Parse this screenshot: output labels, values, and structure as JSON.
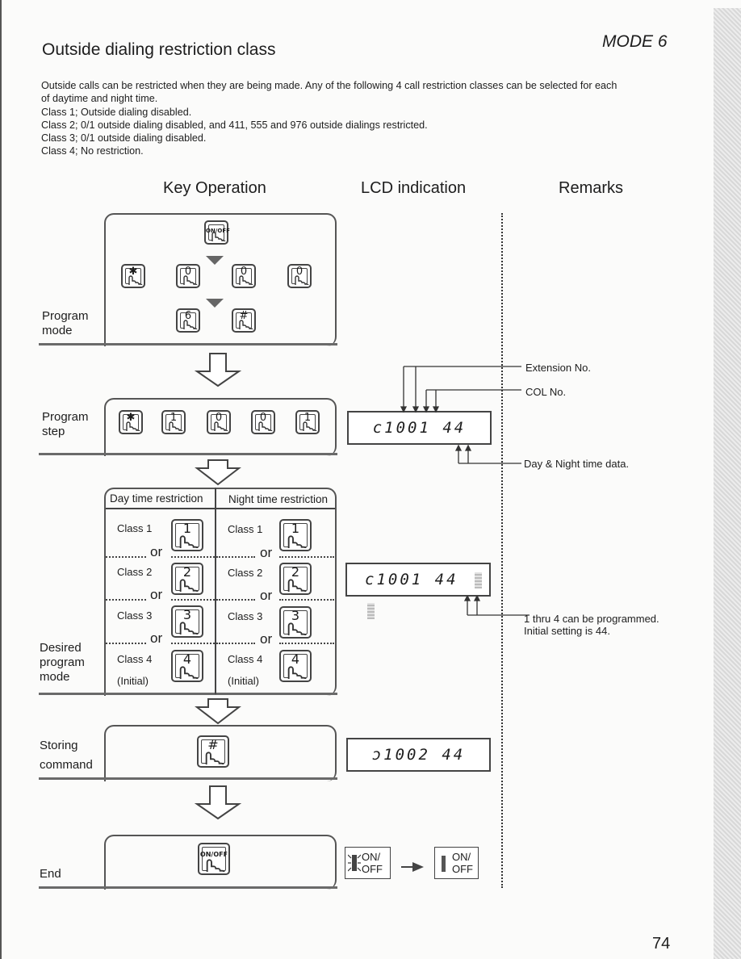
{
  "header": {
    "title": "Outside dialing restriction  class",
    "mode_label": "MODE  6"
  },
  "intro": {
    "lines": [
      "Outside calls can be restricted when they are being made.  Any of the following 4 call restriction classes can be selected for each",
      "of daytime and night time.",
      "Class 1; Outside dialing disabled.",
      "Class 2; 0/1 outside dialing disabled, and 411, 555 and 976 outside dialings restricted.",
      "Class 3; 0/1 outside dialing disabled.",
      "Class 4; No restriction."
    ]
  },
  "columns": {
    "key_operation": "Key Operation",
    "lcd_indication": "LCD  indication",
    "remarks": "Remarks"
  },
  "steps": {
    "program_mode": {
      "label_line1": "Program",
      "label_line2": "mode",
      "keys": {
        "onoff": "ON/OFF",
        "star": "✱",
        "zero": "0",
        "six": "6",
        "hash": "#"
      }
    },
    "program_step": {
      "label_line1": "Program",
      "label_line2": "step",
      "keys": [
        "✱",
        "1",
        "0",
        "0",
        "1"
      ],
      "lcd": "c1001 44",
      "remarks": {
        "extension_no": "Extension No.",
        "col_no": "COL No.",
        "day_night": "Day & Night time data."
      }
    },
    "desired_mode": {
      "label_line1": "Desired",
      "label_line2": "program",
      "label_line3": "mode",
      "day_header": "Day time restriction",
      "night_header": "Night time restriction",
      "or_label": "or",
      "classes": [
        {
          "label": "Class 1",
          "key": "1"
        },
        {
          "label": "Class 2",
          "key": "2"
        },
        {
          "label": "Class 3",
          "key": "3"
        },
        {
          "label": "Class 4",
          "key": "4",
          "note": "(Initial)"
        }
      ],
      "lcd": "c1001 44",
      "remark_line1": "1 thru 4 can be programmed.",
      "remark_line2": "Initial setting is 44."
    },
    "storing": {
      "label_line1": "Storing",
      "label_line2": "command",
      "key": "#",
      "lcd": "ɔ1002 44"
    },
    "end": {
      "label": "End",
      "key": "ON/OFF",
      "indicator_on": "ON/",
      "indicator_off": "OFF"
    }
  },
  "footer": {
    "page_number": "74"
  }
}
